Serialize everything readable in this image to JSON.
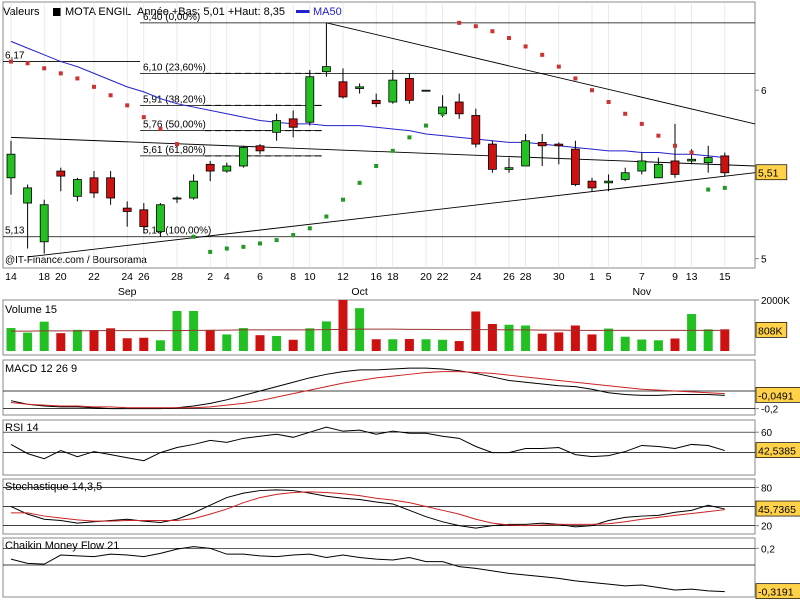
{
  "colors": {
    "up": "#22c022",
    "down": "#cc1111",
    "ma": "#2222cc",
    "sar": "#cc3333",
    "sar_up": "#229922",
    "signal": "#cc2222",
    "label_bg": "#ffd24a",
    "frame": "#888888",
    "grid": "#dddddd"
  },
  "chart_data": [
    {
      "type": "candlestick",
      "panel": "price",
      "header": {
        "label": "Valeurs",
        "symbol": "MOTA ENGIL",
        "stats": "Année +Bas: 5,01 +Haut: 8,35",
        "ma_label": "MA50"
      },
      "credit": "@IT-Finance.com / Boursorama",
      "ylim": [
        4.98,
        6.5
      ],
      "yticks": [
        {
          "v": 6,
          "label": "6"
        },
        {
          "v": 5,
          "label": "5"
        }
      ],
      "last_value": 5.51,
      "last_label": "5,51",
      "left_marks": [
        {
          "v": 6.17,
          "label": "6,17"
        },
        {
          "v": 5.13,
          "label": "5,13"
        }
      ],
      "fib_levels": [
        {
          "v": 6.4,
          "label": "6,40 (0,00%)"
        },
        {
          "v": 6.1,
          "label": "6,10 (23,60%)"
        },
        {
          "v": 5.91,
          "label": "5,91 (38,20%)"
        },
        {
          "v": 5.76,
          "label": "5,76 (50,00%)"
        },
        {
          "v": 5.61,
          "label": "5,61 (61,80%)"
        },
        {
          "v": 5.13,
          "label": "5,13 (100,00%)"
        }
      ],
      "x_day_labels": [
        "14",
        "18",
        "20",
        "22",
        "24",
        "26",
        "28",
        "2",
        "4",
        "6",
        "8",
        "10",
        "12",
        "16",
        "18",
        "20",
        "22",
        "24",
        "26",
        "28",
        "30",
        "1",
        "5",
        "7",
        "9",
        "13",
        "15"
      ],
      "months": [
        "Sep",
        "Oct",
        "Nov"
      ],
      "candles": [
        [
          5.48,
          5.62,
          5.7,
          5.38
        ],
        [
          5.33,
          5.42,
          5.44,
          5.06
        ],
        [
          5.1,
          5.32,
          5.35,
          5.03
        ],
        [
          5.52,
          5.49,
          5.54,
          5.4
        ],
        [
          5.37,
          5.47,
          5.48,
          5.34
        ],
        [
          5.48,
          5.39,
          5.52,
          5.36
        ],
        [
          5.48,
          5.36,
          5.52,
          5.32
        ],
        [
          5.3,
          5.28,
          5.34,
          5.19
        ],
        [
          5.29,
          5.19,
          5.33,
          5.15
        ],
        [
          5.16,
          5.32,
          5.33,
          5.13
        ],
        [
          5.36,
          5.36,
          5.37,
          5.33
        ],
        [
          5.36,
          5.46,
          5.5,
          5.35
        ],
        [
          5.56,
          5.52,
          5.58,
          5.46
        ],
        [
          5.52,
          5.55,
          5.57,
          5.51
        ],
        [
          5.55,
          5.66,
          5.67,
          5.54
        ],
        [
          5.67,
          5.64,
          5.68,
          5.62
        ],
        [
          5.75,
          5.82,
          5.86,
          5.7
        ],
        [
          5.83,
          5.78,
          5.88,
          5.72
        ],
        [
          5.81,
          6.08,
          6.12,
          5.79
        ],
        [
          6.11,
          6.14,
          6.4,
          6.08
        ],
        [
          6.05,
          5.96,
          6.13,
          5.95
        ],
        [
          6.01,
          6.02,
          6.04,
          5.98
        ],
        [
          5.94,
          5.92,
          5.98,
          5.9
        ],
        [
          5.93,
          6.06,
          6.12,
          5.92
        ],
        [
          6.07,
          5.94,
          6.1,
          5.92
        ],
        [
          6.0,
          6.0,
          6.0,
          6.0
        ],
        [
          5.86,
          5.9,
          5.97,
          5.84
        ],
        [
          5.93,
          5.86,
          5.98,
          5.83
        ],
        [
          5.85,
          5.68,
          5.89,
          5.66
        ],
        [
          5.68,
          5.53,
          5.7,
          5.51
        ],
        [
          5.53,
          5.54,
          5.6,
          5.51
        ],
        [
          5.55,
          5.7,
          5.74,
          5.55
        ],
        [
          5.69,
          5.67,
          5.74,
          5.55
        ],
        [
          5.68,
          5.67,
          5.69,
          5.56
        ],
        [
          5.65,
          5.44,
          5.7,
          5.43
        ],
        [
          5.46,
          5.42,
          5.48,
          5.4
        ],
        [
          5.45,
          5.46,
          5.5,
          5.4
        ],
        [
          5.47,
          5.51,
          5.54,
          5.46
        ],
        [
          5.52,
          5.58,
          5.63,
          5.5
        ],
        [
          5.48,
          5.56,
          5.6,
          5.48
        ],
        [
          5.58,
          5.5,
          5.8,
          5.48
        ],
        [
          5.58,
          5.59,
          5.65,
          5.56
        ],
        [
          5.57,
          5.6,
          5.67,
          5.51
        ],
        [
          5.61,
          5.51,
          5.63,
          5.49
        ]
      ],
      "ma50": [
        6.29,
        6.25,
        6.21,
        6.17,
        6.14,
        6.1,
        6.06,
        6.02,
        5.99,
        5.95,
        5.92,
        5.9,
        5.88,
        5.86,
        5.84,
        5.82,
        5.81,
        5.8,
        5.8,
        5.79,
        5.79,
        5.79,
        5.78,
        5.77,
        5.76,
        5.74,
        5.73,
        5.72,
        5.71,
        5.7,
        5.69,
        5.69,
        5.68,
        5.67,
        5.66,
        5.65,
        5.64,
        5.64,
        5.63,
        5.63,
        5.62,
        5.62,
        5.61,
        5.6
      ],
      "sar": [
        6.17,
        6.16,
        6.13,
        6.1,
        6.07,
        6.02,
        5.97,
        5.91,
        5.84,
        5.77,
        5.68,
        5.13,
        5.04,
        5.06,
        5.07,
        5.09,
        5.11,
        5.14,
        5.18,
        5.25,
        5.35,
        5.45,
        5.55,
        5.64,
        5.72,
        5.79,
        5.86,
        6.4,
        6.38,
        6.35,
        6.31,
        6.26,
        6.21,
        6.14,
        6.07,
        6.0,
        5.93,
        5.86,
        5.8,
        5.73,
        5.67,
        5.63,
        5.41,
        5.42
      ],
      "sar_up_from": 11,
      "sar_up_to": 26,
      "sar_up_from2": 42
    },
    {
      "type": "bar",
      "panel": "volume",
      "title": "Volume 15",
      "ylim": [
        0,
        2000
      ],
      "yticks": [
        {
          "v": 2000,
          "label": "2000K"
        }
      ],
      "last_label": "808K",
      "values": [
        900,
        720,
        1150,
        700,
        830,
        820,
        890,
        500,
        520,
        420,
        1570,
        1570,
        830,
        650,
        900,
        620,
        590,
        440,
        890,
        1160,
        2000,
        1680,
        460,
        460,
        470,
        460,
        440,
        390,
        1550,
        1060,
        1030,
        1000,
        680,
        730,
        1000,
        650,
        880,
        560,
        450,
        420,
        490,
        1450,
        850,
        850
      ],
      "avg": [
        780,
        780,
        790,
        790,
        790,
        800,
        800,
        800,
        800,
        800,
        800,
        810,
        810,
        820,
        830,
        830,
        830,
        830,
        830,
        840,
        850,
        860,
        860,
        860,
        850,
        850,
        840,
        840,
        840,
        840,
        830,
        830,
        820,
        820,
        810,
        810,
        810,
        810,
        810,
        810,
        810,
        810,
        810,
        808
      ]
    },
    {
      "type": "line",
      "panel": "macd",
      "title": "MACD 12 26 9",
      "ylim": [
        -0.25,
        0.33
      ],
      "yticks": [
        {
          "v": -0.2,
          "label": "-0,2"
        }
      ],
      "last_label": "-0,0491",
      "ref_line": 0,
      "series": [
        {
          "key": "macd",
          "values": [
            -0.11,
            -0.15,
            -0.17,
            -0.18,
            -0.18,
            -0.19,
            -0.2,
            -0.2,
            -0.2,
            -0.2,
            -0.19,
            -0.17,
            -0.14,
            -0.1,
            -0.05,
            0.0,
            0.05,
            0.1,
            0.15,
            0.19,
            0.22,
            0.24,
            0.24,
            0.25,
            0.26,
            0.26,
            0.25,
            0.23,
            0.2,
            0.16,
            0.12,
            0.1,
            0.08,
            0.06,
            0.05,
            0.02,
            -0.02,
            -0.04,
            -0.05,
            -0.05,
            -0.04,
            -0.04,
            -0.04,
            -0.05
          ]
        },
        {
          "key": "signal",
          "values": [
            -0.13,
            -0.15,
            -0.16,
            -0.17,
            -0.17,
            -0.18,
            -0.18,
            -0.19,
            -0.19,
            -0.19,
            -0.19,
            -0.19,
            -0.18,
            -0.16,
            -0.14,
            -0.11,
            -0.07,
            -0.03,
            0.01,
            0.05,
            0.09,
            0.12,
            0.15,
            0.17,
            0.19,
            0.21,
            0.22,
            0.22,
            0.21,
            0.2,
            0.18,
            0.16,
            0.14,
            0.12,
            0.1,
            0.08,
            0.06,
            0.04,
            0.02,
            0.01,
            0.0,
            -0.01,
            -0.02,
            -0.03
          ]
        }
      ]
    },
    {
      "type": "line",
      "panel": "rsi",
      "title": "RSI 14",
      "ylim": [
        20,
        70
      ],
      "yticks": [
        {
          "v": 60,
          "label": "60"
        }
      ],
      "last_label": "42,5385",
      "ref_line": 40,
      "series": [
        {
          "key": "rsi",
          "values": [
            48,
            39,
            34,
            42,
            36,
            41,
            38,
            35,
            32,
            40,
            45,
            48,
            52,
            50,
            54,
            56,
            58,
            55,
            60,
            65,
            61,
            62,
            58,
            61,
            59,
            59,
            56,
            54,
            46,
            40,
            40,
            44,
            44,
            45,
            38,
            36,
            37,
            41,
            47,
            46,
            44,
            48,
            47,
            42
          ]
        }
      ]
    },
    {
      "type": "line",
      "panel": "stoch",
      "title": "Stochastique 14,3,5",
      "ylim": [
        10,
        90
      ],
      "yticks": [
        {
          "v": 80,
          "label": "80"
        },
        {
          "v": 20,
          "label": "20"
        }
      ],
      "last_label": "45,7365",
      "ref_line": 50,
      "series": [
        {
          "key": "k",
          "values": [
            50,
            38,
            30,
            28,
            24,
            26,
            28,
            30,
            27,
            25,
            30,
            40,
            52,
            64,
            71,
            75,
            76,
            75,
            71,
            66,
            63,
            61,
            57,
            54,
            44,
            34,
            26,
            20,
            16,
            20,
            22,
            22,
            24,
            22,
            18,
            20,
            28,
            33,
            35,
            36,
            41,
            44,
            52,
            46
          ]
        },
        {
          "key": "d",
          "values": [
            40,
            40,
            35,
            32,
            29,
            27,
            27,
            28,
            28,
            28,
            28,
            31,
            38,
            46,
            56,
            64,
            69,
            72,
            73,
            72,
            70,
            67,
            63,
            60,
            56,
            50,
            44,
            38,
            30,
            24,
            21,
            20,
            21,
            22,
            22,
            22,
            23,
            26,
            30,
            33,
            36,
            39,
            42,
            45
          ]
        }
      ]
    },
    {
      "type": "line",
      "panel": "cmf",
      "title": "Chaikin Money Flow 21",
      "ylim": [
        -0.36,
        0.3
      ],
      "yticks": [
        {
          "v": 0.2,
          "label": "0,2"
        }
      ],
      "last_label": "-0,3191",
      "ref_line": 0,
      "series": [
        {
          "key": "cmf",
          "values": [
            0.07,
            0.02,
            0.01,
            0.12,
            0.11,
            0.1,
            0.13,
            0.12,
            0.1,
            0.14,
            0.19,
            0.22,
            0.2,
            0.13,
            0.13,
            0.11,
            0.1,
            0.12,
            0.13,
            0.09,
            0.12,
            0.09,
            0.07,
            0.06,
            0.09,
            0.04,
            0.04,
            -0.02,
            -0.04,
            -0.07,
            -0.1,
            -0.12,
            -0.14,
            -0.16,
            -0.19,
            -0.21,
            -0.23,
            -0.25,
            -0.24,
            -0.27,
            -0.3,
            -0.29,
            -0.31,
            -0.32
          ]
        }
      ]
    }
  ]
}
